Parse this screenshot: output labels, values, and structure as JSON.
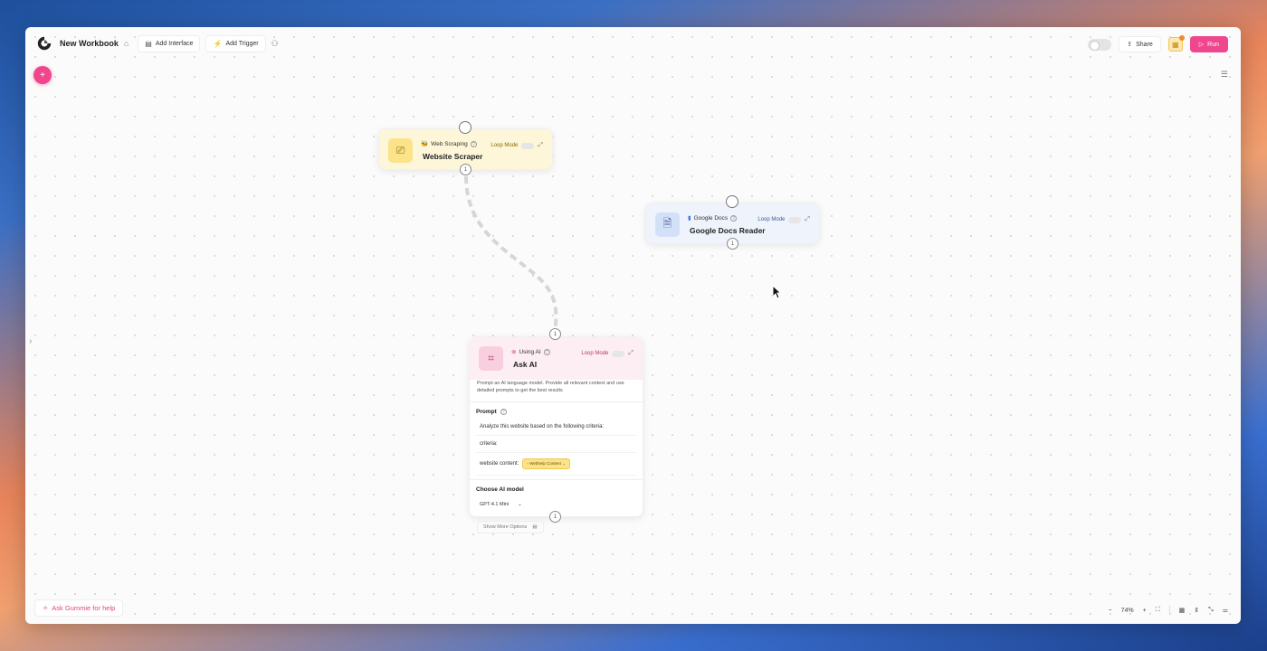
{
  "header": {
    "workbook_title": "New Workbook",
    "add_interface": "Add Interface",
    "add_trigger": "Add Trigger",
    "share": "Share",
    "run": "Run"
  },
  "icons": {
    "logo": "logo-icon",
    "add": "plus-icon",
    "list": "list-icon",
    "sidebar_toggle": "chevron-right-icon"
  },
  "colors": {
    "accent": "#f0468d",
    "scraper_bg": "#fdf6d8",
    "docs_bg": "#eef3fc",
    "ai_bg": "#fdeef3"
  },
  "nodes": {
    "scraper": {
      "category": "Web Scraping",
      "title": "Website Scraper",
      "loop_label": "Loop Mode",
      "out_port": "1"
    },
    "docs": {
      "category": "Google Docs",
      "title": "Google Docs Reader",
      "loop_label": "Loop Mode",
      "out_port": "1"
    },
    "ask_ai": {
      "category": "Using AI",
      "title": "Ask AI",
      "loop_label": "Loop Mode",
      "in_port": "1",
      "out_port": "1",
      "description": "Prompt an AI language model. Provide all relevant context and use detailed prompts to get the best results",
      "prompt_label": "Prompt",
      "prompt_lines": [
        "Analyze this website based on the following criteria:",
        "criteria:",
        "website content:"
      ],
      "chip": "Webhelp Content",
      "model_label": "Choose AI model",
      "model_value": "GPT-4.1 Mini",
      "more_options": "Show More Options"
    }
  },
  "footer": {
    "help": "Ask Gummie for help",
    "zoom": "74%"
  }
}
